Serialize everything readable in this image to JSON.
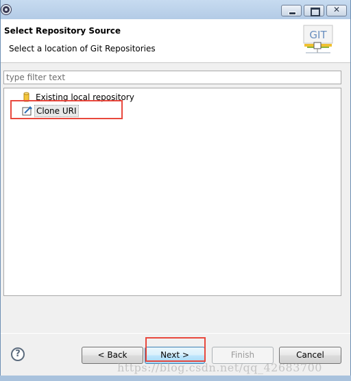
{
  "header": {
    "title": "Select Repository Source",
    "description": "Select a location of Git Repositories",
    "logo_text": "GIT"
  },
  "filter": {
    "placeholder": "type filter text",
    "value": ""
  },
  "tree": {
    "items": [
      {
        "label": "Existing local repository",
        "icon": "database-icon"
      },
      {
        "label": "Clone URI",
        "icon": "clone-uri-icon",
        "selected": true
      }
    ]
  },
  "buttons": {
    "help": "?",
    "back": "< Back",
    "next": "Next >",
    "finish": "Finish",
    "cancel": "Cancel"
  },
  "watermark": "https://blog.csdn.net/qq_42683700",
  "colors": {
    "highlight": "#e8473c",
    "title_bar": "#b9cfe8"
  }
}
